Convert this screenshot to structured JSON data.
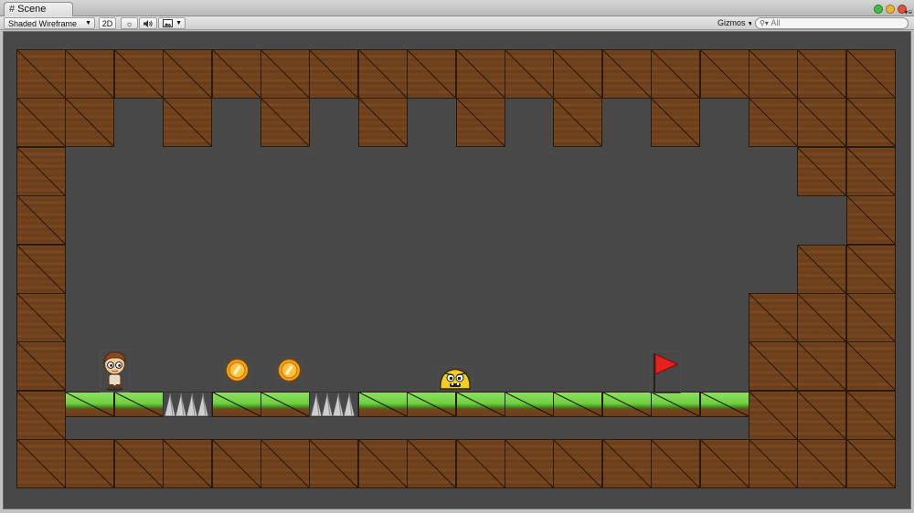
{
  "window": {
    "tab_title": "Scene",
    "tab_icon": "scene-grid-icon",
    "controls": [
      {
        "name": "window-zoom-button",
        "color": "#3fbf3f"
      },
      {
        "name": "window-minimize-button",
        "color": "#f0b030"
      },
      {
        "name": "window-close-button",
        "color": "#e0503a"
      }
    ]
  },
  "toolbar": {
    "draw_mode": "Shaded Wireframe",
    "mode_2d": "2D",
    "lighting_icon": "sun-icon",
    "audio_icon": "speaker-icon",
    "effects_icon": "image-icon",
    "gizmos_label": "Gizmos",
    "search_placeholder": "All",
    "search_icon": "search-icon"
  },
  "scene": {
    "background_color": "#484848",
    "dirt_color": "#70431d",
    "grass_color": "#6fcf3f",
    "player": "player-character",
    "coins": [
      "coin",
      "coin"
    ],
    "enemy": "blob-enemy",
    "goal": "goal-flag"
  }
}
